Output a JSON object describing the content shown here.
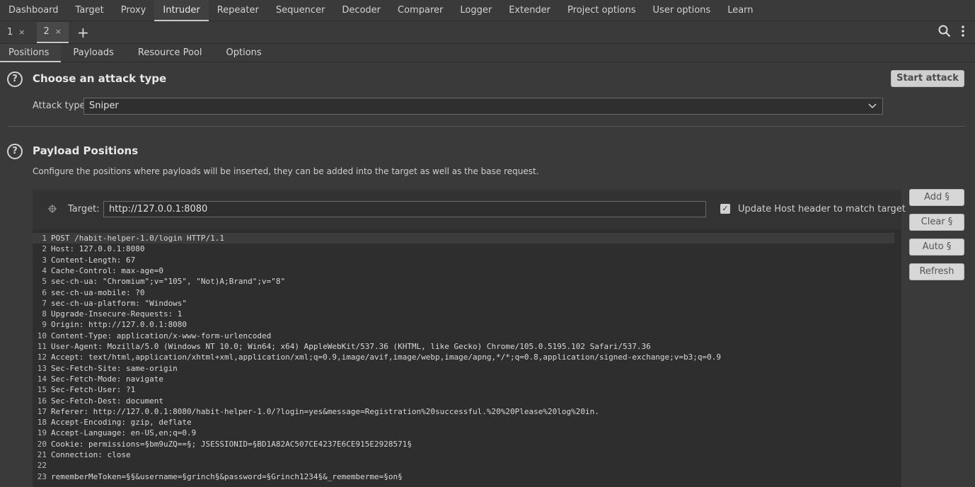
{
  "nav": {
    "tabs": [
      "Dashboard",
      "Target",
      "Proxy",
      "Intruder",
      "Repeater",
      "Sequencer",
      "Decoder",
      "Comparer",
      "Logger",
      "Extender",
      "Project options",
      "User options",
      "Learn"
    ],
    "active": "Intruder"
  },
  "instances": {
    "tabs": [
      {
        "label": "1",
        "close": "×"
      },
      {
        "label": "2",
        "close": "×"
      }
    ],
    "add": "+"
  },
  "config_tabs": [
    "Positions",
    "Payloads",
    "Resource Pool",
    "Options"
  ],
  "attack": {
    "title": "Choose an attack type",
    "label": "Attack type:",
    "value": "Sniper",
    "start_button": "Start attack"
  },
  "positions": {
    "title": "Payload Positions",
    "description": "Configure the positions where payloads will be inserted, they can be added into the target as well as the base request.",
    "target_label": "Target:",
    "target_value": "http://127.0.0.1:8080",
    "update_host_label": "Update Host header to match target",
    "update_host_checked": true,
    "buttons": {
      "add": "Add §",
      "clear": "Clear §",
      "auto": "Auto §",
      "refresh": "Refresh"
    }
  },
  "request_lines": [
    "POST /habit-helper-1.0/login HTTP/1.1",
    "Host: 127.0.0.1:8080",
    "Content-Length: 67",
    "Cache-Control: max-age=0",
    "sec-ch-ua: \"Chromium\";v=\"105\", \"Not)A;Brand\";v=\"8\"",
    "sec-ch-ua-mobile: ?0",
    "sec-ch-ua-platform: \"Windows\"",
    "Upgrade-Insecure-Requests: 1",
    "Origin: http://127.0.0.1:8080",
    "Content-Type: application/x-www-form-urlencoded",
    "User-Agent: Mozilla/5.0 (Windows NT 10.0; Win64; x64) AppleWebKit/537.36 (KHTML, like Gecko) Chrome/105.0.5195.102 Safari/537.36",
    "Accept: text/html,application/xhtml+xml,application/xml;q=0.9,image/avif,image/webp,image/apng,*/*;q=0.8,application/signed-exchange;v=b3;q=0.9",
    "Sec-Fetch-Site: same-origin",
    "Sec-Fetch-Mode: navigate",
    "Sec-Fetch-User: ?1",
    "Sec-Fetch-Dest: document",
    "Referer: http://127.0.0.1:8080/habit-helper-1.0/?login=yes&message=Registration%20successful.%20%20Please%20log%20in.",
    "Accept-Encoding: gzip, deflate",
    "Accept-Language: en-US,en;q=0.9",
    "Cookie: permissions=§bm9uZQ==§; JSESSIONID=§BD1A82AC507CE4237E6CE915E2928571§",
    "Connection: close",
    "",
    "rememberMeToken=§§&username=§grinch§&password=§Grinch1234§&_rememberme=§on§"
  ]
}
